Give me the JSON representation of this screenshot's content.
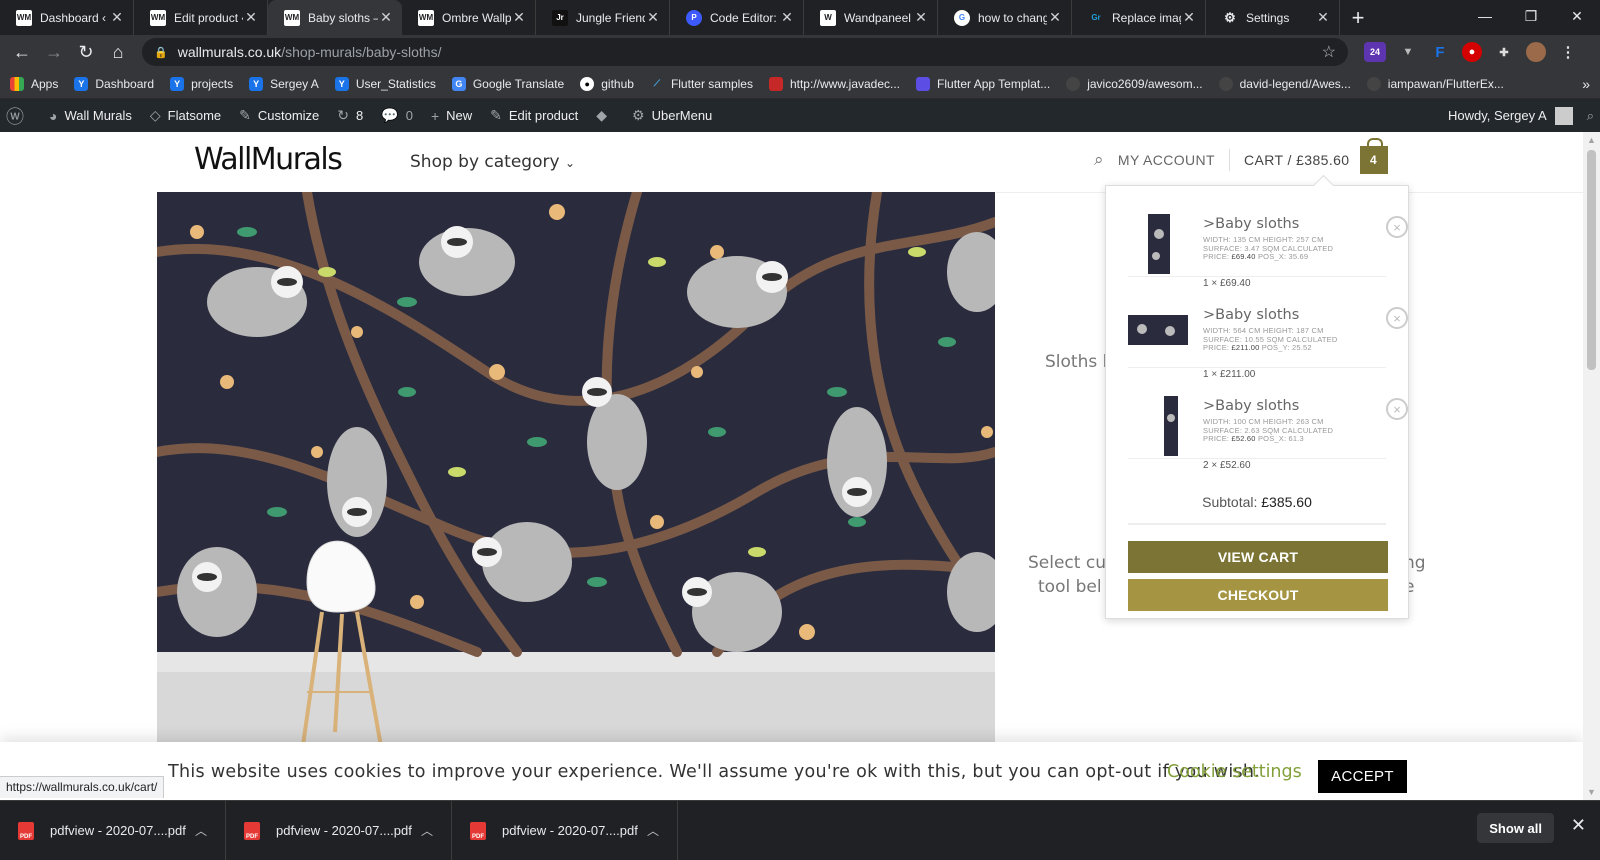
{
  "browser": {
    "tabs": [
      {
        "favicon": "WM",
        "title": "Dashboard ‹ W"
      },
      {
        "favicon": "WM",
        "title": "Edit product ‹"
      },
      {
        "favicon": "WM",
        "title": "Baby sloths –"
      },
      {
        "favicon": "WM",
        "title": "Ombre Wallp"
      },
      {
        "favicon": "Jr",
        "title": "Jungle Friend"
      },
      {
        "favicon": "P",
        "title": "Code Editor: w"
      },
      {
        "favicon": "W",
        "title": "Wandpaneel"
      },
      {
        "favicon": "G",
        "title": "how to chang"
      },
      {
        "favicon": "Gr",
        "title": "Replace imag"
      },
      {
        "favicon": "⚙",
        "title": "Settings"
      }
    ],
    "new_tab": "+",
    "url_host": "wallmurals.co.uk",
    "url_path": "/shop-murals/baby-sloths/",
    "ext_badge": "24",
    "bookmarks": [
      {
        "label": "Apps",
        "color": "#ea4335"
      },
      {
        "label": "Dashboard",
        "color": "#1a73e8"
      },
      {
        "label": "projects",
        "color": "#1a73e8"
      },
      {
        "label": "Sergey A",
        "color": "#1a73e8"
      },
      {
        "label": "User_Statistics",
        "color": "#1a73e8"
      },
      {
        "label": "Google Translate",
        "color": "#4285f4"
      },
      {
        "label": "github",
        "color": "#555"
      },
      {
        "label": "Flutter samples",
        "color": "#45b0f0"
      },
      {
        "label": "http://www.javadec...",
        "color": "#c62828"
      },
      {
        "label": "Flutter App Templat...",
        "color": "#5c4ee5"
      },
      {
        "label": "javico2609/awesom...",
        "color": "#444"
      },
      {
        "label": "david-legend/Awes...",
        "color": "#444"
      },
      {
        "label": "iampawan/FlutterEx...",
        "color": "#444"
      }
    ],
    "bookmarks_more": "»"
  },
  "wp_admin": {
    "site": "Wall Murals",
    "theme": "Flatsome",
    "customize": "Customize",
    "updates": "8",
    "comments": "0",
    "new": "New",
    "edit": "Edit product",
    "ubermenu": "UberMenu",
    "howdy": "Howdy, Sergey A"
  },
  "site": {
    "logo": "WallMurals",
    "shop_menu": "Shop by category",
    "my_account": "MY ACCOUNT",
    "cart_label": "CART / £385.60",
    "cart_count": "4",
    "accent_color": "#7c7434"
  },
  "product": {
    "text_fragment_1": "Sloths l",
    "text_fragment_2": "Select cu",
    "text_fragment_3": "ng",
    "text_fragment_4": "tool bel",
    "text_fragment_5": "e"
  },
  "minicart": {
    "items": [
      {
        "name": ">Baby sloths",
        "meta": "WIDTH: 135 CM  HEIGHT: 257 CM  SURFACE: 3.47 SQM CALCULATED PRICE:",
        "price_meta": "£69.40",
        "pos": "POS_X: 35.69",
        "qty": "1 × £69.40"
      },
      {
        "name": ">Baby sloths",
        "meta": "WIDTH: 564 CM  HEIGHT: 187 CM  SURFACE: 10.55 SQM CALCULATED PRICE:",
        "price_meta": "£211.00",
        "pos": "POS_Y: 25.52",
        "qty": "1 × £211.00"
      },
      {
        "name": ">Baby sloths",
        "meta": "WIDTH: 100 CM  HEIGHT: 263 CM  SURFACE: 2.63 SQM CALCULATED PRICE:",
        "price_meta": "£52.60",
        "pos": "POS_X: 61.3",
        "qty": "2 × £52.60"
      }
    ],
    "subtotal_label": "Subtotal:",
    "subtotal_value": "£385.60",
    "view_cart": "VIEW CART",
    "checkout": "CHECKOUT"
  },
  "cookie": {
    "message": "This website uses cookies to improve your experience. We'll assume you're ok with this, but you can opt-out if you wish.",
    "settings": "Cookie settings",
    "accept": "ACCEPT"
  },
  "status_url": "https://wallmurals.co.uk/cart/",
  "downloads": {
    "items": [
      "pdfview - 2020-07....pdf",
      "pdfview - 2020-07....pdf",
      "pdfview - 2020-07....pdf"
    ],
    "show_all": "Show all"
  }
}
